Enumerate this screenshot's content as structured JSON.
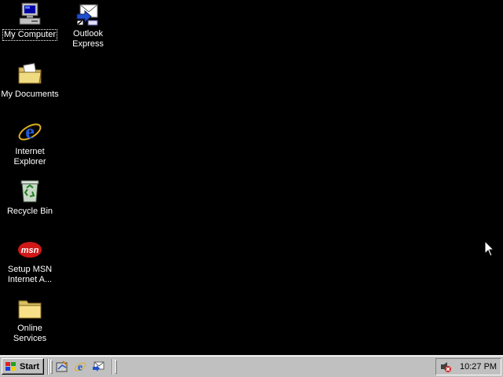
{
  "desktop": {
    "background_color": "#000000",
    "icons": [
      {
        "label": "My Computer",
        "icon": "my-computer-icon",
        "selected": true
      },
      {
        "label": "Outlook Express",
        "icon": "outlook-express-icon",
        "selected": false
      },
      {
        "label": "My Documents",
        "icon": "my-documents-icon",
        "selected": false
      },
      {
        "label": "Internet Explorer",
        "icon": "internet-explorer-icon",
        "selected": false
      },
      {
        "label": "Recycle Bin",
        "icon": "recycle-bin-icon",
        "selected": false
      },
      {
        "label": "Setup MSN Internet A...",
        "icon": "msn-icon",
        "selected": false
      },
      {
        "label": "Online Services",
        "icon": "folder-icon",
        "selected": false
      }
    ]
  },
  "taskbar": {
    "start_label": "Start",
    "quick_launch": [
      "show-desktop-icon",
      "internet-explorer-icon",
      "outlook-express-icon"
    ],
    "tray": {
      "icons": [
        "volume-tray-icon"
      ],
      "clock": "10:27 PM"
    },
    "colors": {
      "face": "#c0c0c0",
      "shadow": "#808080",
      "highlight": "#ffffff"
    }
  }
}
